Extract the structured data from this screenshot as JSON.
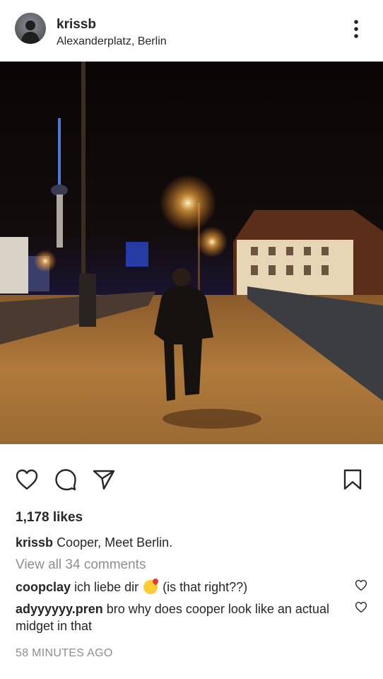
{
  "post": {
    "username": "krissb",
    "location": "Alexanderplatz, Berlin",
    "likes": "1,178 likes",
    "caption_user": "krissb",
    "caption_text": "Cooper, Meet Berlin.",
    "view_all_comments": "View all 34 comments",
    "timestamp": "58 MINUTES AGO"
  },
  "comments": [
    {
      "user": "coopclay",
      "text_before": "ich liebe dir",
      "emoji": "kissing-face-with-heart-emoji",
      "text_after": "(is that right??)"
    },
    {
      "user": "adyyyyyy.pren",
      "text": "bro why does cooper look like an actual midget in that"
    }
  ],
  "icons": {
    "more": "more-options-icon",
    "like": "heart-icon",
    "comment": "comment-icon",
    "share": "share-icon",
    "save": "bookmark-icon",
    "comment_like": "heart-icon"
  },
  "colors": {
    "text": "#262626",
    "secondary_text": "#8e8e8e",
    "background": "#ffffff"
  }
}
